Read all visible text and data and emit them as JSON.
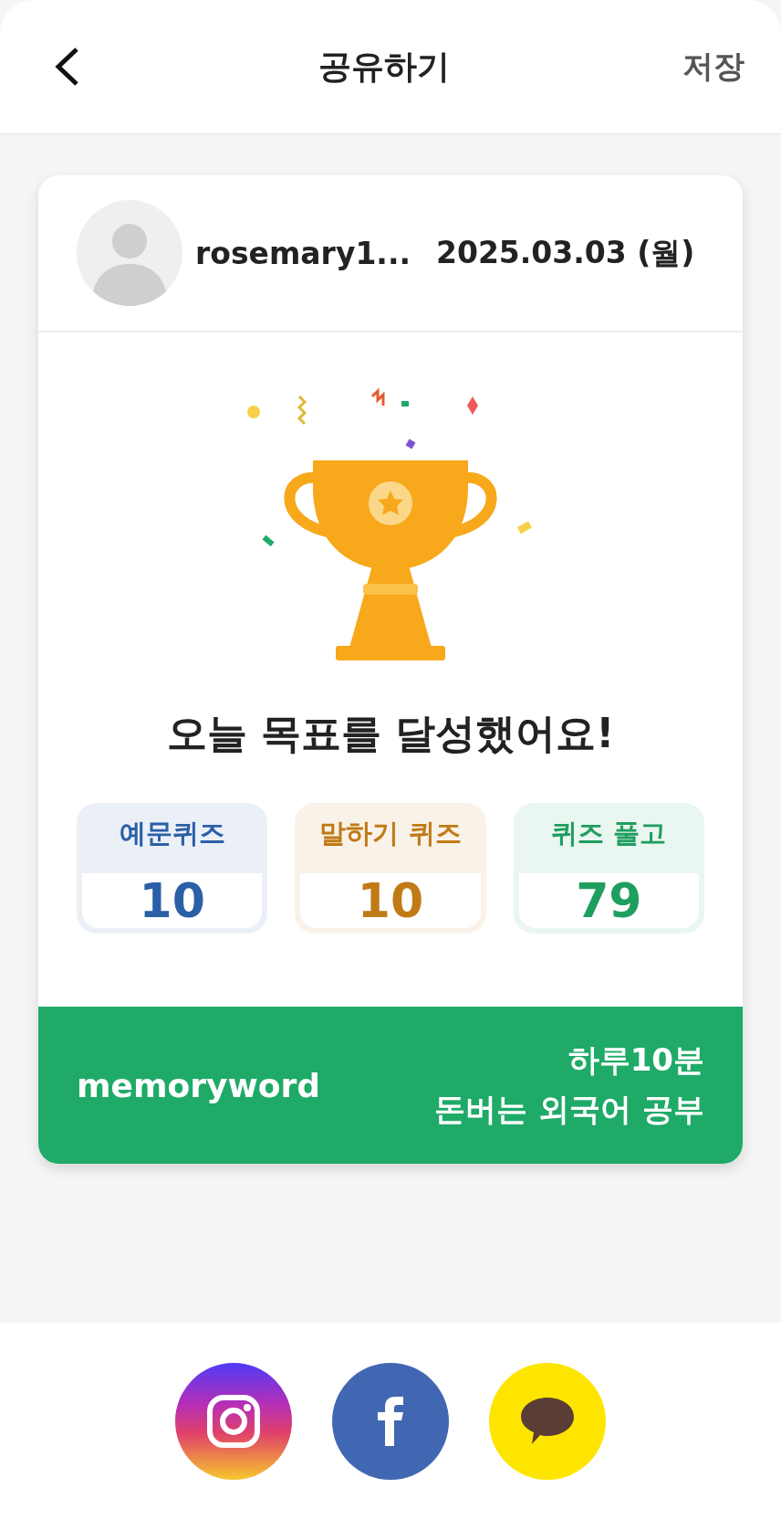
{
  "header": {
    "title": "공유하기",
    "action": "저장"
  },
  "card": {
    "username": "rosemary1...",
    "date": "2025.03.03 (월)",
    "headline": "오늘 목표를 달성했어요!",
    "stats": [
      {
        "label": "예문퀴즈",
        "value": "10",
        "color": "#2b5fa8"
      },
      {
        "label": "말하기 퀴즈",
        "value": "10",
        "color": "#c07a16"
      },
      {
        "label": "퀴즈 풀고",
        "value": "79",
        "color": "#1f9e5f"
      }
    ],
    "footer": {
      "brand": "memoryword",
      "tagline_1": "하루10분",
      "tagline_2": "돈버는 외국어 공부"
    }
  },
  "share": [
    {
      "kind": "instagram"
    },
    {
      "kind": "facebook"
    },
    {
      "kind": "kakaotalk"
    }
  ]
}
